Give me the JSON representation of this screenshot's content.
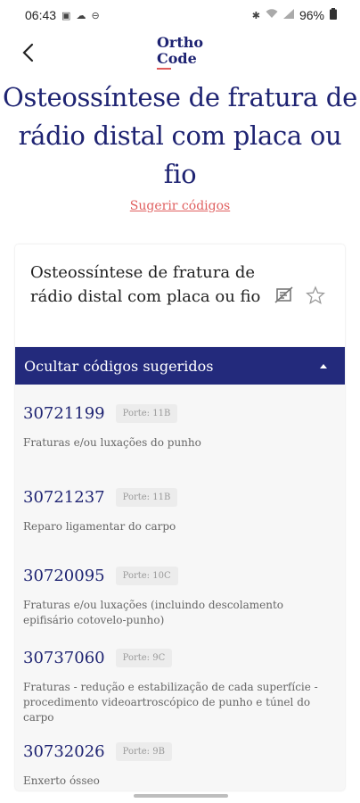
{
  "status_bar": {
    "time": "06:43",
    "battery": "96%"
  },
  "app": {
    "logo_line1": "Ortho",
    "logo_line2": "Code"
  },
  "page": {
    "title": "Osteossíntese de fratura de rádio distal com placa ou fio",
    "suggest_link": "Sugerir códigos"
  },
  "card": {
    "title": "Osteossíntese de fratura de rádio distal com placa ou fio",
    "toggle_label": "Ocultar códigos sugeridos"
  },
  "codes": [
    {
      "code": "30721199",
      "porte": "Porte: 11B",
      "description": "Fraturas e/ou luxações do punho"
    },
    {
      "code": "30721237",
      "porte": "Porte: 11B",
      "description": "Reparo ligamentar do carpo"
    },
    {
      "code": "30720095",
      "porte": "Porte: 10C",
      "description": "Fraturas e/ou luxações (incluindo descolamento epifisário cotovelo-punho)"
    },
    {
      "code": "30737060",
      "porte": "Porte: 9C",
      "description": "Fraturas - redução e estabilização de cada superfície - procedimento videoartroscópico de punho e túnel do carpo"
    },
    {
      "code": "30732026",
      "porte": "Porte: 9B",
      "description": "Enxerto ósseo"
    }
  ],
  "colors": {
    "brand_navy": "#1e2372",
    "toggle_bar": "#232a7c",
    "accent_red": "#e06060"
  }
}
